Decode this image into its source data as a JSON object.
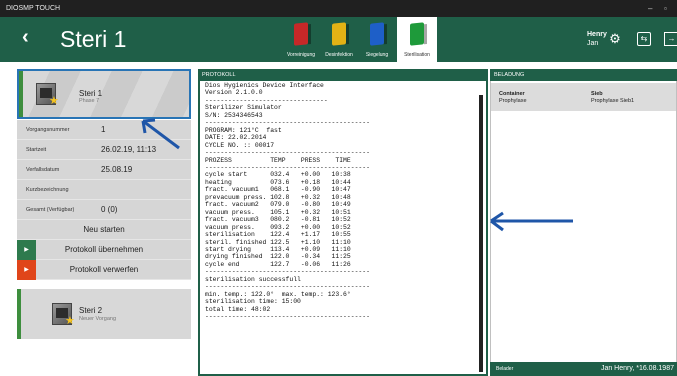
{
  "window": {
    "title": "DIOSMP TOUCH",
    "minimize": "–",
    "maximize": "▫"
  },
  "header": {
    "back": "‹",
    "title": "Steri 1",
    "tabs": [
      {
        "label": "Vorreinigung",
        "color": "#c62828"
      },
      {
        "label": "Desinfektion",
        "color": "#e2b215"
      },
      {
        "label": "Siegelung",
        "color": "#1e5fc8"
      },
      {
        "label": "Sterilisation",
        "color": "#1e9a3a"
      }
    ],
    "user_first": "Henry",
    "user_last": "Jan",
    "icons": [
      "gear-icon",
      "switch-icon",
      "logout-icon"
    ]
  },
  "left": {
    "card1": {
      "name": "Steri 1",
      "sub": "Phase 7"
    },
    "props": [
      {
        "k": "Vorgangsnummer",
        "v": "1"
      },
      {
        "k": "Startzeit",
        "v": "26.02.19, 11:13"
      },
      {
        "k": "Verfallsdatum",
        "v": "25.08.19"
      },
      {
        "k": "Kurzbezeichnung",
        "v": ""
      },
      {
        "k": "Gesamt (Verfügbar)",
        "v": "0 (0)"
      }
    ],
    "restart": "Neu starten",
    "accept": {
      "label": "Protokoll übernehmen",
      "color": "#2e7a4d"
    },
    "discard": {
      "label": "Protokoll verwerfen",
      "color": "#e0451a"
    },
    "card2": {
      "name": "Steri 2",
      "sub": "Neuer Vorgang"
    }
  },
  "protokoll": {
    "heading": "PROTOKOLL",
    "text": "Dios Hygienics Device Interface\nVersion 2.1.0.0\n--------------------------------\nSterilizer Simulator\nS/N: 2534346543\n-------------------------------------------\nPROGRAM: 121°C  fast\nDATE: 22.02.2014\nCYCLE NO. :: 00017\n-------------------------------------------\nPROZESS          TEMP    PRESS    TIME\n-------------------------------------------\ncycle start      032.4   +0.00   10:38\nheating          073.6   +0.18   10:44\nfract. vacuum1   068.1   -0.90   10:47\nprevacuum press. 102.8   +0.32   10:48\nfract. vacuum2   079.0   -0.80   10:49\nvacuum press.    105.1   +0.32   10:51\nfract. vacuum3   080.2   -0.81   10:52\nvacuum press.    093.2   +0.00   10:52\nsterilisation    122.4   +1.17   10:55\nsteril. finished 122.5   +1.10   11:10\nstart drying     113.4   +0.09   11:10\ndrying finished  122.0   -0.34   11:25\ncycle end        122.7   -0.06   11:26\n-------------------------------------------\nsterilisation successfull\n-------------------------------------------\nmin. temp.: 122.0°  max. temp.: 123.6°\nsterilisation time: 15:00\ntotal time: 48:02\n-------------------------------------------"
  },
  "beladung": {
    "heading": "BELADUNG",
    "col1_head": "Container",
    "col1_val": "Prophylaxe",
    "col2_head": "Sieb",
    "col2_val": "Prophylaxe Sieb1",
    "footer_left": "Belader",
    "footer_right": "Jan Henry, *16.08.1987"
  }
}
